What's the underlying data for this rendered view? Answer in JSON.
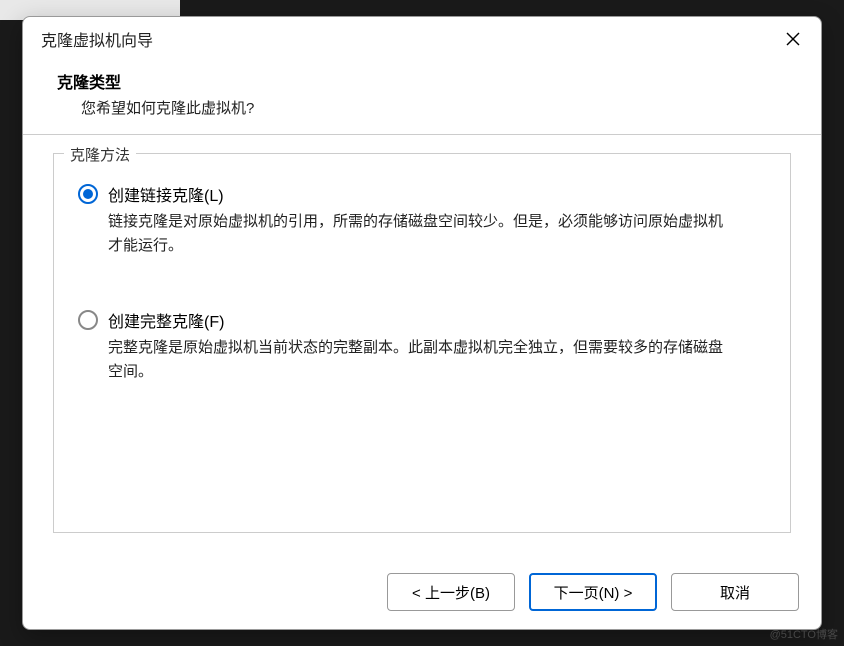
{
  "dialog": {
    "title": "克隆虚拟机向导"
  },
  "header": {
    "title": "克隆类型",
    "subtitle": "您希望如何克隆此虚拟机?"
  },
  "fieldset": {
    "legend": "克隆方法"
  },
  "options": {
    "linked": {
      "label": "创建链接克隆(L)",
      "desc": "链接克隆是对原始虚拟机的引用，所需的存储磁盘空间较少。但是，必须能够访问原始虚拟机才能运行。",
      "selected": true
    },
    "full": {
      "label": "创建完整克隆(F)",
      "desc": "完整克隆是原始虚拟机当前状态的完整副本。此副本虚拟机完全独立，但需要较多的存储磁盘空间。",
      "selected": false
    }
  },
  "buttons": {
    "back": "< 上一步(B)",
    "next": "下一页(N) >",
    "cancel": "取消"
  },
  "watermark": "@51CTO博客"
}
